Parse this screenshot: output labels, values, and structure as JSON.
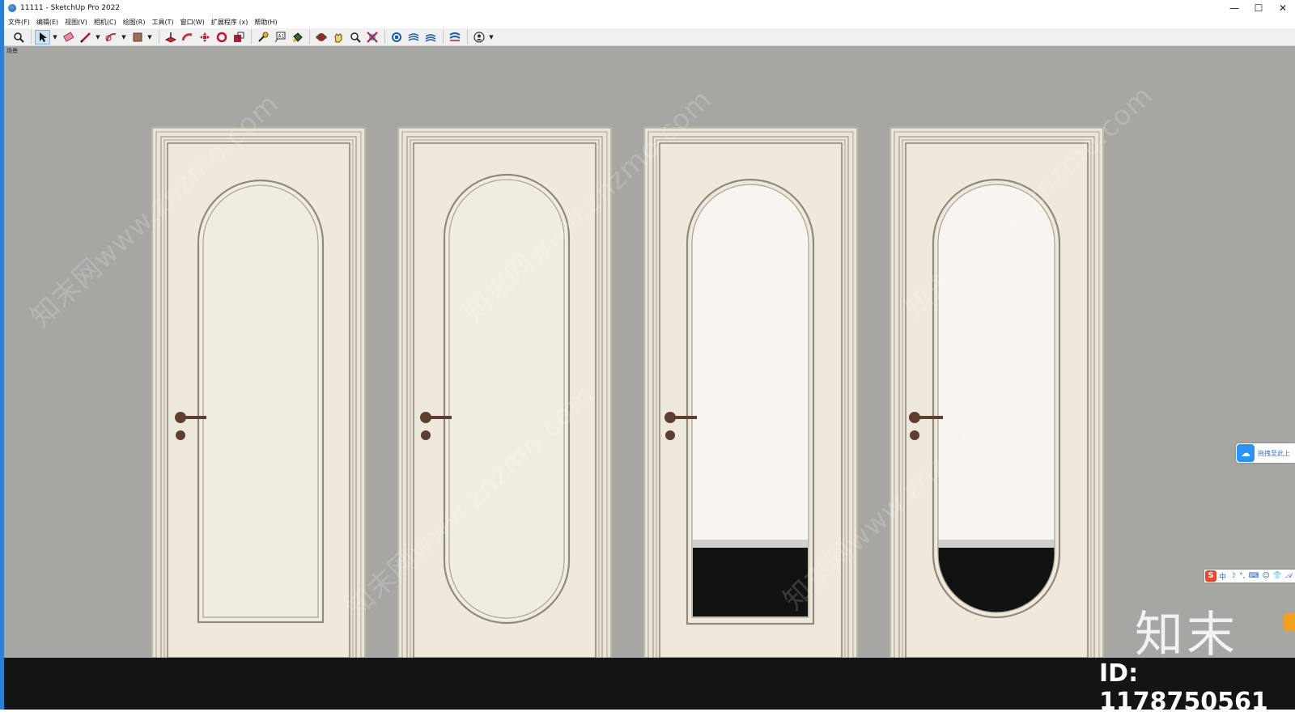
{
  "window": {
    "title": "11111 - SketchUp Pro 2022",
    "minimize": "—",
    "maximize": "☐",
    "close": "✕"
  },
  "menu": [
    "文件(F)",
    "编辑(E)",
    "视图(V)",
    "相机(C)",
    "绘图(R)",
    "工具(T)",
    "窗口(W)",
    "扩展程序 (x)",
    "帮助(H)"
  ],
  "toolbar": {
    "icons": [
      "zoom-icon",
      "select-icon",
      "eraser-icon",
      "pencil-icon",
      "arc-icon",
      "shape-icon",
      "push-pull-icon",
      "follow-me-icon",
      "move-icon",
      "rotate-icon",
      "scale-icon",
      "tape-measure-icon",
      "text-icon",
      "paint-bucket-icon",
      "orbit-icon",
      "pan-icon",
      "zoom-window-icon",
      "zoom-extents-icon",
      "warehouse-icon",
      "extension-warehouse-icon",
      "layout-icon",
      "styles-icon",
      "account-icon"
    ],
    "active_tool": "select-icon"
  },
  "viewport": {
    "scene_tab": "场景",
    "background_color": "#a6a6a3",
    "floor_color": "#141414"
  },
  "doors": [
    {
      "style": "arched-panel",
      "glass": false
    },
    {
      "style": "stadium-panel",
      "glass": false
    },
    {
      "style": "arched-glass",
      "glass": true
    },
    {
      "style": "stadium-glass",
      "glass": true
    }
  ],
  "colors": {
    "door_panel": "#efe9dd",
    "frame": "#ebe5d8",
    "molding": "#8e8a80",
    "handle": "#5c3f30",
    "glass": "#f8f4ef"
  },
  "widgets": {
    "baidu_upload": "拖拽至此上",
    "ime": [
      "中",
      "☽",
      "°,",
      "⌨",
      "☺",
      "👕",
      "𝒜"
    ],
    "ime_logo": "S"
  },
  "watermark": {
    "text": "知末网www.znzmo.com",
    "brand": "知末",
    "id": "ID: 1178750561"
  }
}
